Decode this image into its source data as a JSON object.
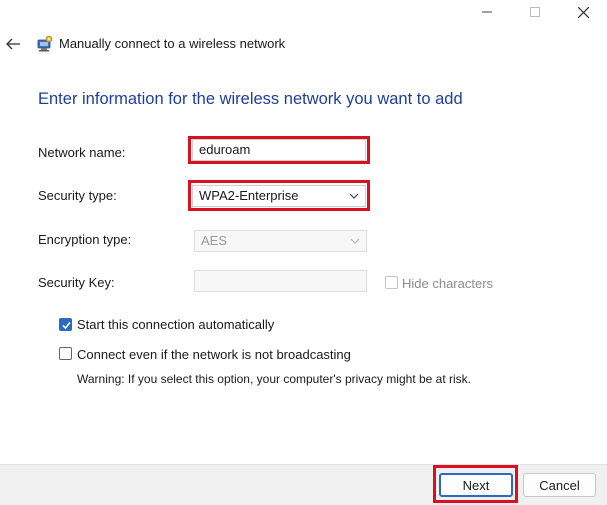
{
  "window": {
    "controls": [
      "minimize-icon",
      "maximize-icon",
      "close-icon"
    ]
  },
  "header": {
    "back_icon": "back-arrow-icon",
    "wizard_icon": "network-wizard-icon",
    "title": "Manually connect to a wireless network"
  },
  "main": {
    "heading": "Enter information for the wireless network you want to add",
    "network_name": {
      "label": "Network name:",
      "value": "eduroam"
    },
    "security_type": {
      "label": "Security type:",
      "value": "WPA2-Enterprise"
    },
    "encryption_type": {
      "label": "Encryption type:",
      "value": "AES"
    },
    "security_key": {
      "label": "Security Key:",
      "value": "",
      "hide_characters_label": "Hide characters"
    },
    "start_automatically": {
      "label": "Start this connection automatically",
      "checked": true
    },
    "connect_not_broadcasting": {
      "label": "Connect even if the network is not broadcasting",
      "checked": false
    },
    "warning": "Warning: If you select this option, your computer's privacy might be at risk."
  },
  "footer": {
    "next_label": "Next",
    "cancel_label": "Cancel"
  },
  "colors": {
    "heading": "#1e3f99",
    "highlight": "#d8101f",
    "checkbox_checked": "#2a6bc0"
  }
}
